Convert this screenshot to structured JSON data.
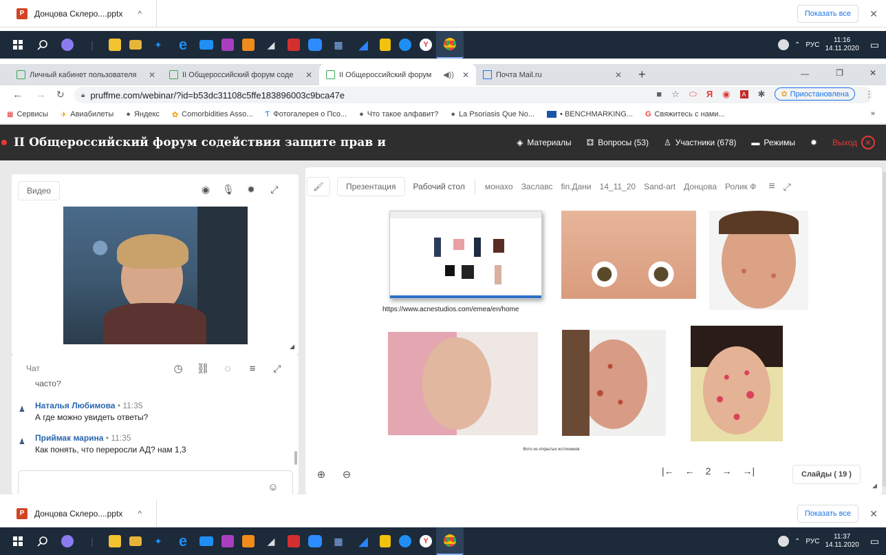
{
  "download_bar": {
    "file_name": "Донцова Склеро....pptx",
    "chevron": "^",
    "show_all": "Показать все",
    "close": "✕"
  },
  "taskbar": {
    "tray_lang": "РУС",
    "time_top": "11:16",
    "date_top": "14.11.2020",
    "time_bottom": "11:37",
    "date_bottom": "14.11.2020"
  },
  "browser": {
    "tabs": [
      {
        "label": "Личный кабинет пользователя",
        "close": "✕"
      },
      {
        "label": "II Общероссийский форум соде",
        "close": "✕"
      },
      {
        "label": "II Общероссийский форум",
        "close": "✕"
      },
      {
        "label": "Почта Mail.ru",
        "close": "✕"
      }
    ],
    "new_tab": "+",
    "url": "pruffme.com/webinar/?id=b53dc31108c5ffe183896003c9bca47e",
    "profile": "Приостановлена",
    "bookmarks": [
      "Сервисы",
      "Авиабилеты",
      "Яндекс",
      "Comorbidities Asso...",
      "Фотогалерея о Псо...",
      "Что такое алфавит?",
      "La Psoriasis Que No...",
      "• BENCHMARKING...",
      "Свяжитесь с нами..."
    ],
    "more": "»"
  },
  "header": {
    "title": "II Общероссийский форум содействия защите прав и",
    "nav": {
      "materials": "Материалы",
      "questions": "Вопросы (53)",
      "participants": "Участники (678)",
      "modes": "Режимы",
      "exit": "Выход"
    }
  },
  "video": {
    "label": "Видео"
  },
  "chat": {
    "label": "Чат",
    "partial": "часто?",
    "messages": [
      {
        "name": "Наталья Любимова",
        "time": "• 11:35",
        "text": "А где можно увидеть ответы?"
      },
      {
        "name": "Приймак марина",
        "time": "• 11:35",
        "text": "Как понять, что переросли АД? нам 1,3"
      }
    ]
  },
  "presentation": {
    "tabs": [
      "Презентация",
      "Рабочий стол",
      "монахо",
      "Заславс",
      "fin.Дани",
      "14_11_20",
      "Sand-art",
      "Донцова",
      "Ролик Ф"
    ],
    "slide_caption": "https://www.acnestudios.com/emea/en/home",
    "slide_footer": "Фото из открытых источников",
    "page": "2",
    "slides_count": "Слайды ( 19 )"
  }
}
